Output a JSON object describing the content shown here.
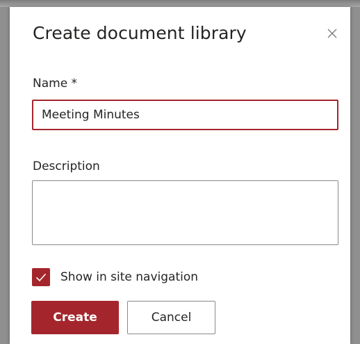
{
  "dialog": {
    "title": "Create document library",
    "name_label": "Name *",
    "name_value": "Meeting Minutes",
    "description_label": "Description",
    "description_value": "",
    "show_in_nav_label": "Show in site navigation",
    "show_in_nav_checked": true,
    "create_label": "Create",
    "cancel_label": "Cancel",
    "close_icon": "close-icon"
  },
  "colors": {
    "accent": "#a4262c",
    "text": "#252423",
    "border": "#8a8886",
    "overlay": "#8f8f8f"
  }
}
